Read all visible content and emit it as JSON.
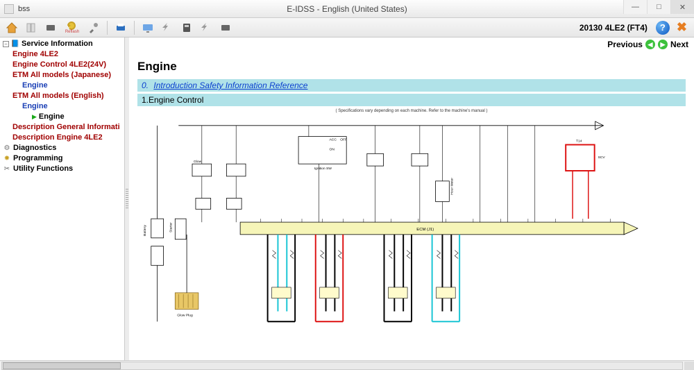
{
  "window": {
    "small_label": "bss",
    "title": "E-IDSS - English (United States)"
  },
  "toolbar": {
    "reflash_label": "Reflash",
    "right_label": "20130 4LE2 (FT4)"
  },
  "nav": {
    "previous": "Previous",
    "next": "Next"
  },
  "tree": {
    "service_info": "Service Information",
    "engine_4le2": "Engine 4LE2",
    "engine_control_4le2_24v": "Engine Control 4LE2(24V)",
    "etm_jp": "ETM All models (Japanese)",
    "engine_jp": "Engine",
    "etm_en": "ETM All models (English)",
    "engine_en": "Engine",
    "engine_leaf": "Engine",
    "desc_general": "Description General Informati",
    "desc_engine_4le2": "Description Engine 4LE2",
    "diagnostics": "Diagnostics",
    "programming": "Programming",
    "utility": "Utility Functions"
  },
  "content": {
    "title": "Engine",
    "section0_num": "0.",
    "section0_link": "Introduction Safety Information Reference",
    "section1": "1.Engine Control",
    "spec_note": "( Specifications vary depending on each machine. Refer to the machine's manual )",
    "diagram_labels": {
      "acc": "ACC",
      "off": "OFF",
      "on": "ON",
      "ignition_sw": "Ignition SW",
      "glow": "Glow",
      "starter": "Starter",
      "battery": "Battery",
      "ecm": "ECM (J1)",
      "hour_meter": "Hour Meter",
      "scv": "SCV",
      "t14": "T14",
      "glow_plug": "Glow Plug"
    }
  }
}
